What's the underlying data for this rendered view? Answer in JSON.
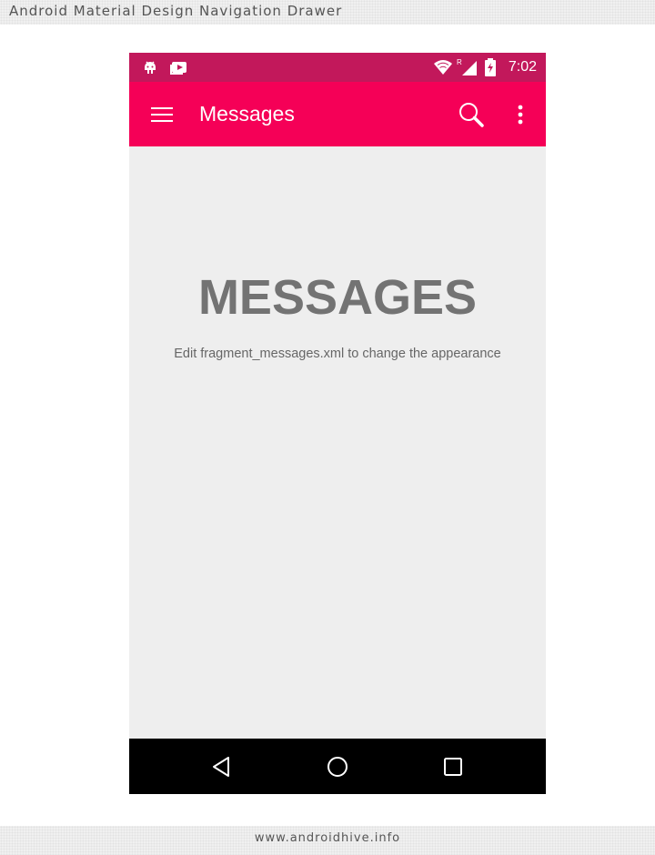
{
  "page": {
    "header_title": "Android Material Design Navigation Drawer",
    "footer_text": "www.androidhive.info"
  },
  "status_bar": {
    "left_icons": [
      "android-debug-icon",
      "media-notification-icon"
    ],
    "right_icons": [
      "wifi-icon",
      "cellular-roaming-icon",
      "battery-charging-icon"
    ],
    "roaming_label": "R",
    "time": "7:02"
  },
  "toolbar": {
    "title": "Messages",
    "menu_icon": "hamburger-menu-icon",
    "search_icon": "search-icon",
    "overflow_icon": "overflow-menu-icon"
  },
  "content": {
    "heading": "MESSAGES",
    "hint": "Edit fragment_messages.xml to change the appearance"
  },
  "nav_bar": {
    "icons": [
      "back-icon",
      "home-icon",
      "recents-icon"
    ]
  },
  "colors": {
    "status_bar": "#c2185b",
    "toolbar": "#f50057",
    "content_bg": "#eeeeee",
    "heading_text": "#737373",
    "nav_bar": "#000000"
  }
}
